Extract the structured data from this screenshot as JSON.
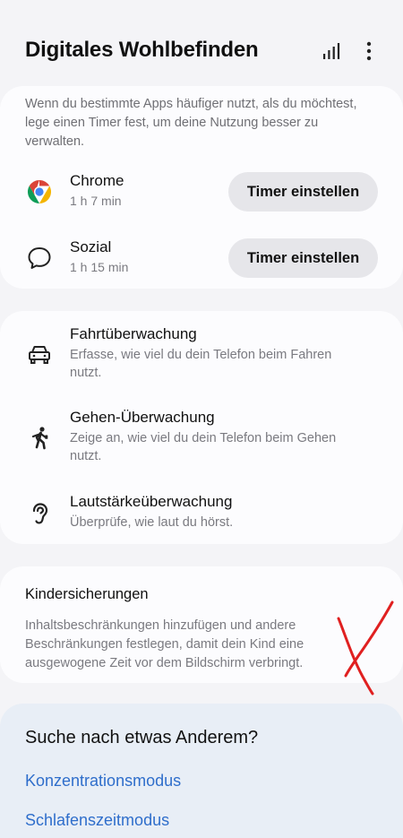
{
  "header": {
    "title": "Digitales Wohlbefinden",
    "stats_icon": "bar-chart-icon",
    "more_icon": "more-vert-icon"
  },
  "timers": {
    "description": "Wenn du bestimmte Apps häufiger nutzt, als du möchtest, lege einen Timer fest, um deine Nutzung besser zu verwalten.",
    "apps": [
      {
        "name": "Chrome",
        "time": "1 h 7 min",
        "icon": "chrome-icon",
        "button": "Timer einstellen"
      },
      {
        "name": "Sozial",
        "time": "1 h 15 min",
        "icon": "chat-bubble-icon",
        "button": "Timer einstellen"
      }
    ]
  },
  "monitors": [
    {
      "title": "Fahrtüberwachung",
      "subtitle": "Erfasse, wie viel du dein Telefon beim Fahren nutzt.",
      "icon": "car-icon"
    },
    {
      "title": "Gehen-Überwachung",
      "subtitle": "Zeige an, wie viel du dein Telefon beim Gehen nutzt.",
      "icon": "walking-icon"
    },
    {
      "title": "Lautstärkeüberwachung",
      "subtitle": "Überprüfe, wie laut du hörst.",
      "icon": "ear-icon"
    }
  ],
  "parental": {
    "title": "Kindersicherungen",
    "description": "Inhaltsbeschränkungen hinzufügen und andere Beschränkungen festlegen, damit dein Kind eine ausgewogene Zeit vor dem Bildschirm verbringt."
  },
  "other": {
    "title": "Suche nach etwas Anderem?",
    "links": [
      "Konzentrationsmodus",
      "Schlafenszeitmodus"
    ]
  },
  "colors": {
    "background": "#f4f4f7",
    "card": "#fcfcfe",
    "link": "#2f6ecb",
    "annotation": "#e02020"
  }
}
